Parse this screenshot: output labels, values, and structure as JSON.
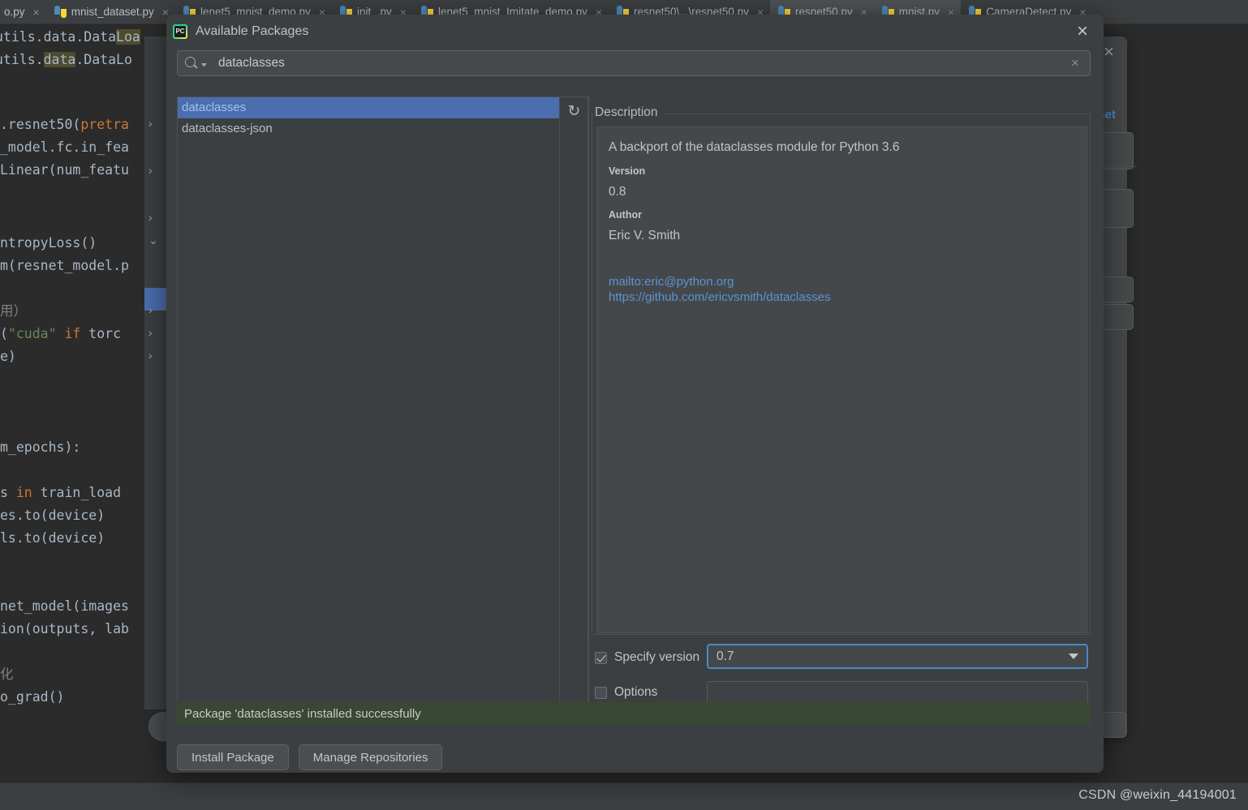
{
  "ide": {
    "tabs": [
      {
        "label": "o.py",
        "icon": "python-file-icon",
        "active": false,
        "partial": true
      },
      {
        "label": "mnist_dataset.py",
        "icon": "python-file-icon",
        "active": false
      },
      {
        "label": "lenet5_mnist_demo.py",
        "icon": "python-file-icon",
        "active": false
      },
      {
        "label": "init_.py",
        "icon": "python-file-icon",
        "active": false
      },
      {
        "label": "lenet5_mnist_Imitate_demo.py",
        "icon": "python-file-icon",
        "active": false
      },
      {
        "label": "resnet50\\...\\resnet50.py",
        "icon": "python-file-icon",
        "active": false
      },
      {
        "label": "resnet50.py",
        "icon": "python-file-icon",
        "active": true
      },
      {
        "label": "mnist.py",
        "icon": "python-file-icon",
        "active": true
      },
      {
        "label": "CameraDetect.py",
        "icon": "python-file-icon",
        "active": false
      }
    ],
    "close_glyph": "×",
    "code_lines": [
      "utils.data.DataLoa",
      "utils.data.DataLo",
      "",
      "",
      ".resnet50(pretra",
      "_model.fc.in_fea",
      "Linear(num_featu",
      "",
      "",
      "ntropyLoss()",
      "m(resnet_model.p",
      "",
      "用）",
      "(\"cuda\" if torc",
      "e)",
      "",
      "",
      "",
      "m_epochs):",
      "",
      "s in train_load",
      "es.to(device)",
      "ls.to(device)",
      "",
      "",
      "net_model(images",
      "ion(outputs, lab",
      "",
      "化",
      "o_grad()"
    ],
    "watermark": "CSDN @weixin_44194001",
    "background_dialog": {
      "reset_link": "set",
      "close_glyph": "×"
    }
  },
  "modal": {
    "title": "Available Packages",
    "title_icon": "pycharm-logo-icon",
    "close_glyph": "×",
    "search": {
      "icon": "search-icon",
      "value": "dataclasses",
      "placeholder": "",
      "clear_glyph": "×"
    },
    "package_list": {
      "refresh_icon": "refresh-icon",
      "refresh_glyph": "↻",
      "items": [
        {
          "name": "dataclasses",
          "selected": true
        },
        {
          "name": "dataclasses-json",
          "selected": false
        }
      ]
    },
    "description": {
      "title": "Description",
      "summary": "A backport of the dataclasses module for Python 3.6",
      "version_label": "Version",
      "version_value": "0.8",
      "author_label": "Author",
      "author_value": "Eric V. Smith",
      "links": [
        "mailto:eric@python.org",
        "https://github.com/ericvsmith/dataclasses"
      ]
    },
    "options": {
      "specify_version_label": "Specify version",
      "specify_version_checked": true,
      "version_selected": "0.7",
      "version_caret_icon": "chevron-down-icon",
      "options_label": "Options",
      "options_checked": false,
      "options_value": ""
    },
    "status": {
      "message": "Package 'dataclasses' installed successfully",
      "background": "#3a4734"
    },
    "buttons": [
      {
        "label": "Install Package",
        "name": "install-package-button"
      },
      {
        "label": "Manage Repositories",
        "name": "manage-repositories-button"
      }
    ]
  },
  "colors": {
    "accent": "#4b6eaf",
    "focus_border": "#4a88c7",
    "link": "#5894d4",
    "success_bg": "#3a4734",
    "dialog_bg": "#3c3f41",
    "editor_bg": "#2b2b2b"
  }
}
